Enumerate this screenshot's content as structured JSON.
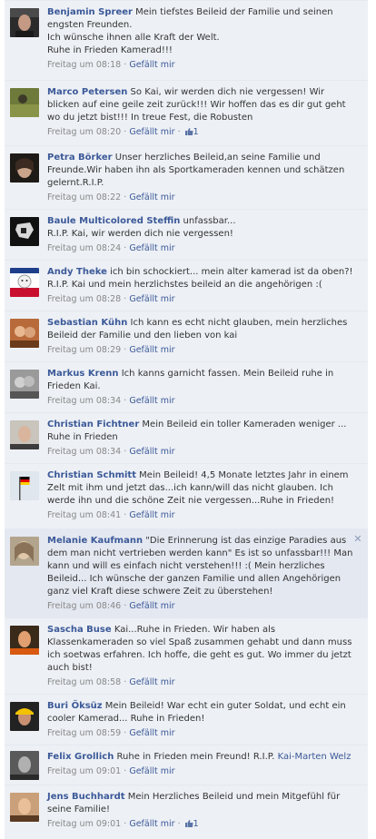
{
  "ui": {
    "separator": "·",
    "like_label": "Gefällt mir",
    "close_glyph": "✕"
  },
  "colors": {
    "author_link": "#3b5998",
    "comment_bg": "#edf0f5",
    "highlight_bg": "#e4e8f1",
    "meta_text": "#888888"
  },
  "comments": [
    {
      "author": "Benjamin Spreer",
      "text": " Mein tiefstes Beileid der Familie und seinen engsten Freunden.\nIch wünsche ihnen alle Kraft der Welt.\nRuhe in Frieden Kamerad!!!",
      "time": "Freitag um 08:18",
      "avatar": "photo-dark-portrait"
    },
    {
      "author": "Marco Petersen",
      "text": " So Kai, wir werden dich nie vergessen! Wir blicken auf eine geile zeit zurück!!! Wir hoffen das es dir gut geht wo du jetzt bist!!! In treue Fest, die Robusten",
      "time": "Freitag um 08:20",
      "avatar": "photo-green-field",
      "likes": "1"
    },
    {
      "author": "Petra Börker",
      "text": " Unser herzliches Beileid,an seine Familie und Freunde.Wir haben ihn als Sportkameraden kennen und schätzen gelernt.R.I.P.",
      "time": "Freitag um 08:22",
      "avatar": "photo-dark-hair"
    },
    {
      "author": "Baule Multicolored Steffin",
      "text": " unfassbar...\nR.I.P. Kai, wir werden dich nie vergessen!",
      "time": "Freitag um 08:24",
      "avatar": "logo-dark-emblem"
    },
    {
      "author": "Andy Theke",
      "text": " ich bin schockiert... mein alter kamerad ist da oben?! R.I.P. Kai und mein herzlichstes beileid an die angehörigen :(",
      "time": "Freitag um 08:28",
      "avatar": "logo-bear-flag"
    },
    {
      "author": "Sebastian Kühn",
      "text": " Ich kann es echt nicht glauben, mein herzliches Beileid der Familie und den lieben von kai",
      "time": "Freitag um 08:29",
      "avatar": "photo-couple"
    },
    {
      "author": "Markus Krenn",
      "text": " Ich kanns garnicht fassen. Mein Beileid ruhe in Frieden Kai.",
      "time": "Freitag um 08:34",
      "avatar": "photo-grey-couple"
    },
    {
      "author": "Christian Fichtner",
      "text": " Mein Beileid ein toller Kameraden weniger ... Ruhe in Frieden",
      "time": "Freitag um 08:34",
      "avatar": "photo-man-light"
    },
    {
      "author": "Christian Schmitt",
      "text": " Mein Beileid! 4,5 Monate letztes Jahr in einem Zelt mit ihm und jetzt das...ich kann/will das nicht glauben. Ich werde ihn und die schöne Zeit nie vergessen...Ruhe in Frieden!",
      "time": "Freitag um 08:41",
      "avatar": "photo-flag-sky"
    },
    {
      "author": "Melanie Kaufmann",
      "text": " \"Die Erinnerung ist das einzige Paradies aus dem man nicht vertrieben werden kann\" Es ist so unfassbar!!! Man kann und will es einfach nicht verstehen!!! :( Mein herzliches Beileid... Ich wünsche der ganzen Familie und allen Angehörigen ganz viel Kraft diese schwere Zeit zu überstehen!",
      "time": "Freitag um 08:46",
      "avatar": "photo-woman-beige",
      "highlight": true
    },
    {
      "author": "Sascha Buse",
      "text": " Kai...Ruhe in Frieden. Wir haben als Klassenkameraden so viel Spaß zusammen gehabt und dann muss ich soetwas erfahren. Ich hoffe, die geht es gut. Wo immer du jetzt auch bist!",
      "time": "Freitag um 08:58",
      "avatar": "photo-man-orange"
    },
    {
      "author": "Buri Öksüz",
      "text": " Mein Beileid! War echt ein guter Soldat, und echt ein cooler Kamerad... Ruhe in Frieden!",
      "time": "Freitag um 08:59",
      "avatar": "photo-cap-yellow"
    },
    {
      "author": "Felix Grollich",
      "text": " Ruhe in Frieden mein Freund! R.I.P. ",
      "mention": "Kai-Marten Welz",
      "time": "Freitag um 09:01",
      "avatar": "photo-grey-man"
    },
    {
      "author": "Jens Buchhardt",
      "text": " Mein Herzliches Beileid und mein Mitgefühl für seine Familie!",
      "time": "Freitag um 09:01",
      "avatar": "photo-man-warm",
      "likes": "1"
    }
  ]
}
